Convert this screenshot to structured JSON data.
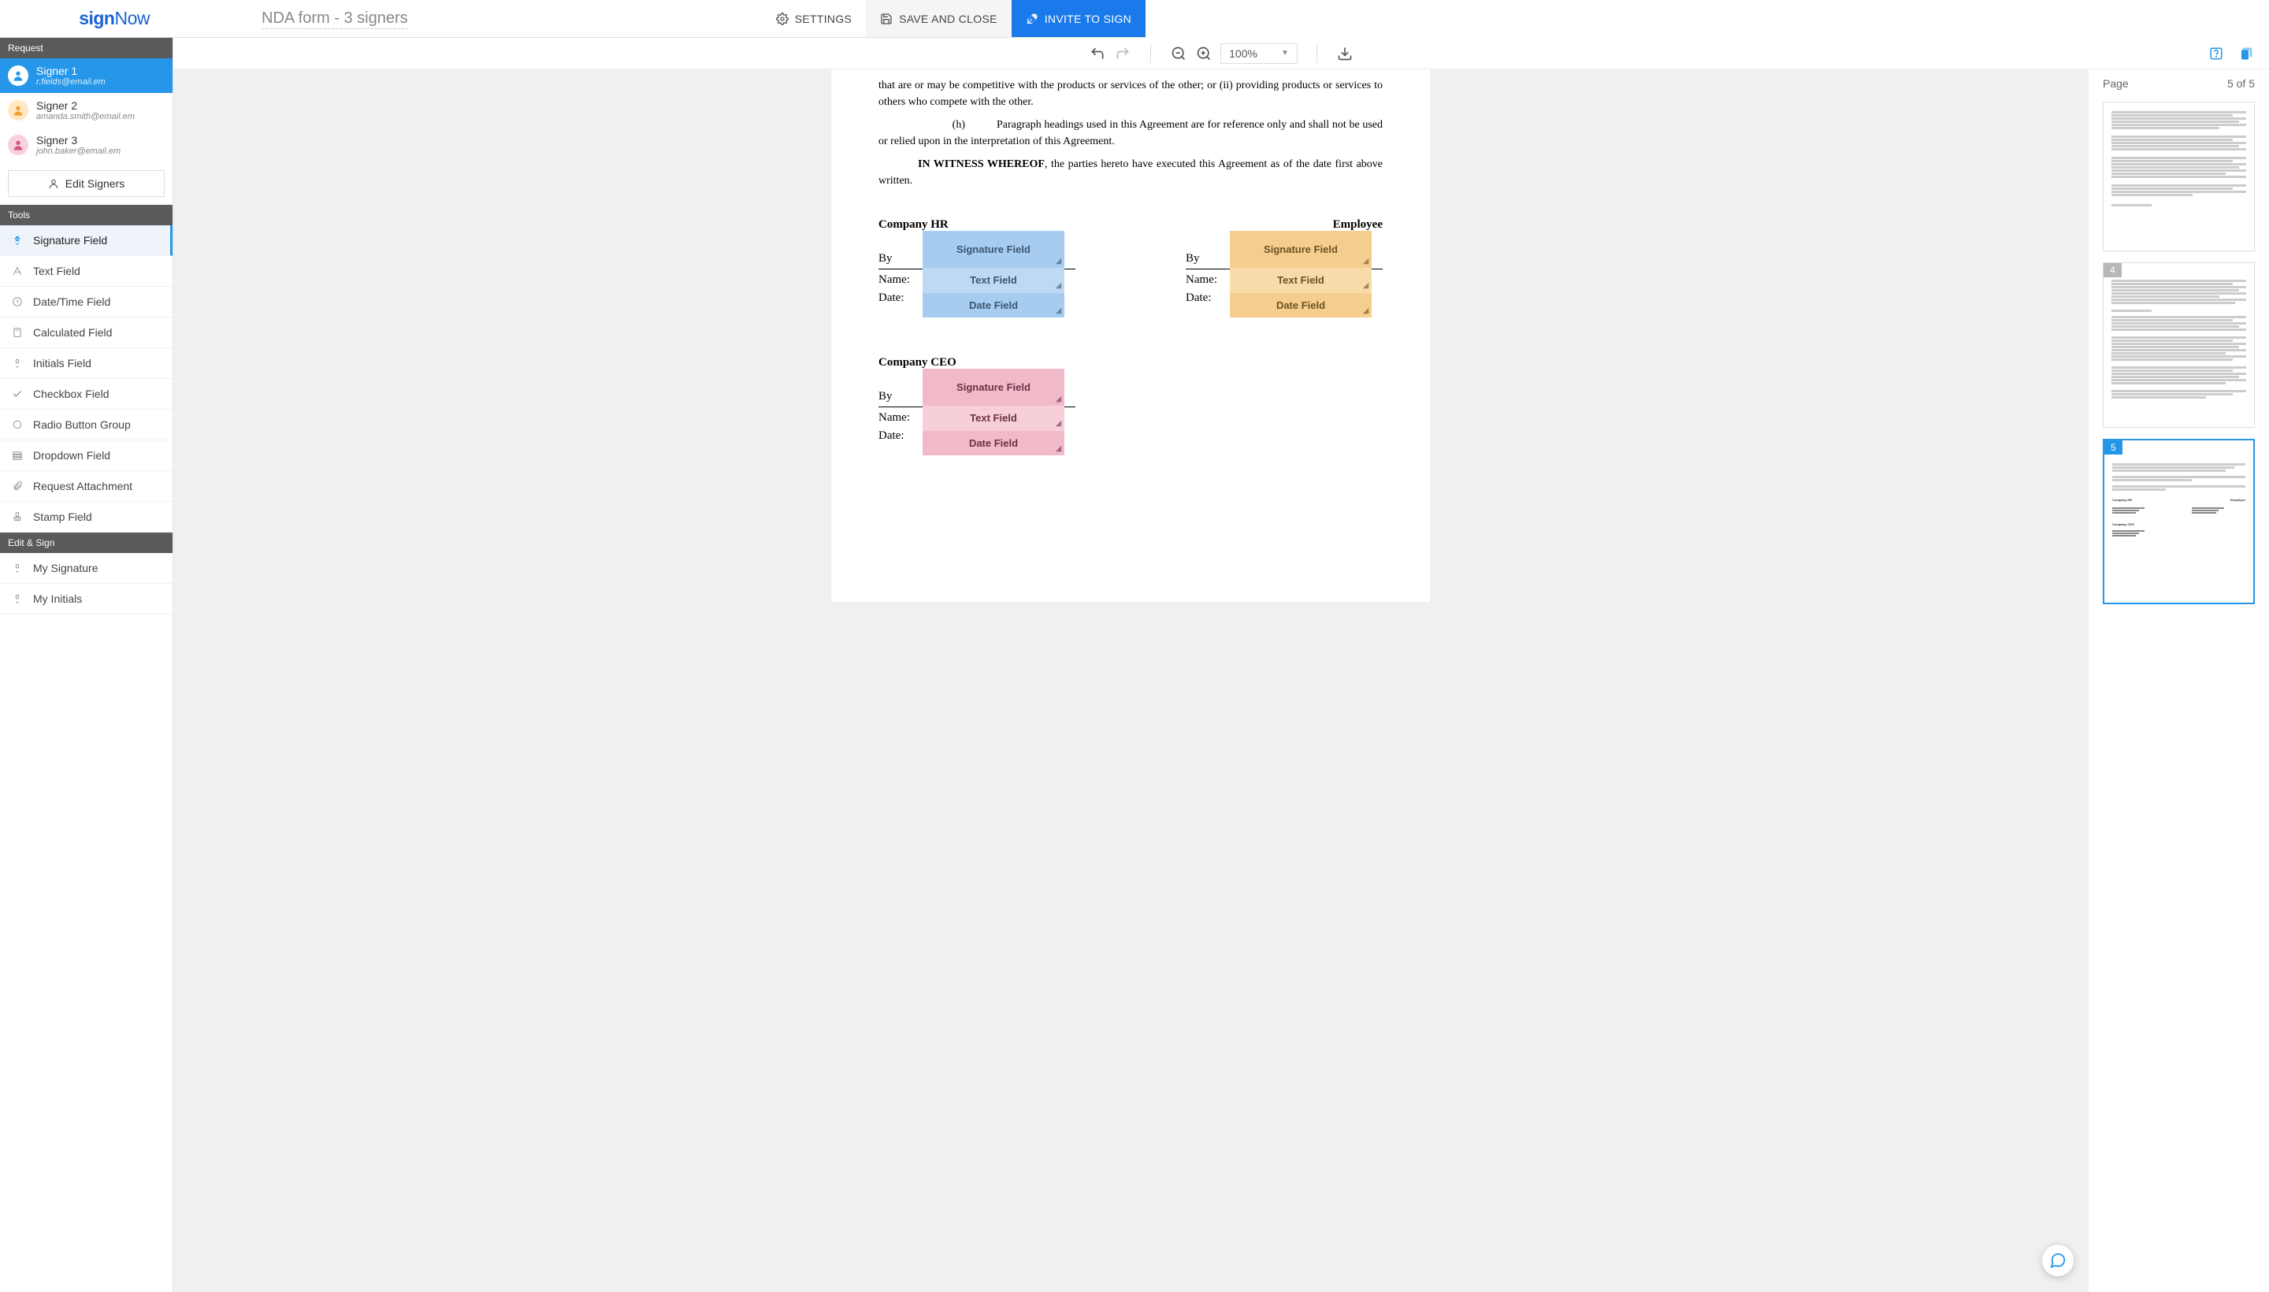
{
  "brand": {
    "part1": "sign",
    "part2": "Now"
  },
  "doc_title": "NDA form - 3 signers",
  "header_buttons": {
    "settings": "SETTINGS",
    "save": "SAVE AND CLOSE",
    "invite": "INVITE TO SIGN"
  },
  "toolbar": {
    "zoom": "100%"
  },
  "sidebar": {
    "request_label": "Request",
    "signers": [
      {
        "name": "Signer 1",
        "email": "r.fields@email.em"
      },
      {
        "name": "Signer 2",
        "email": "amanda.smith@email.em"
      },
      {
        "name": "Signer 3",
        "email": "john.baker@email.em"
      }
    ],
    "edit_signers": "Edit Signers",
    "tools_label": "Tools",
    "tools": [
      "Signature Field",
      "Text Field",
      "Date/Time Field",
      "Calculated Field",
      "Initials Field",
      "Checkbox Field",
      "Radio Button Group",
      "Dropdown Field",
      "Request Attachment",
      "Stamp Field"
    ],
    "edit_sign_label": "Edit & Sign",
    "edit_sign_tools": [
      "My Signature",
      "My Initials"
    ]
  },
  "document": {
    "para1": "that are or may be competitive with the products or services of the other; or (ii) providing products or services to others who compete with the other.",
    "para2_prefix": "(h)",
    "para2": "Paragraph headings used in this Agreement are for reference only and shall not be used or relied upon in the interpretation of this Agreement.",
    "witness_bold": "IN WITNESS WHEREOF",
    "witness_rest": ", the parties hereto have executed this Agreement as of the date first above written.",
    "role_hr": "Company HR",
    "role_employee": "Employee",
    "role_ceo": "Company CEO",
    "labels": {
      "by": "By",
      "name": "Name:",
      "date": "Date:"
    },
    "field_labels": {
      "signature": "Signature Field",
      "text": "Text Field",
      "date": "Date Field"
    }
  },
  "thumbs": {
    "page_label": "Page",
    "counter": "5 of 5",
    "pages": [
      "4",
      "5"
    ]
  }
}
